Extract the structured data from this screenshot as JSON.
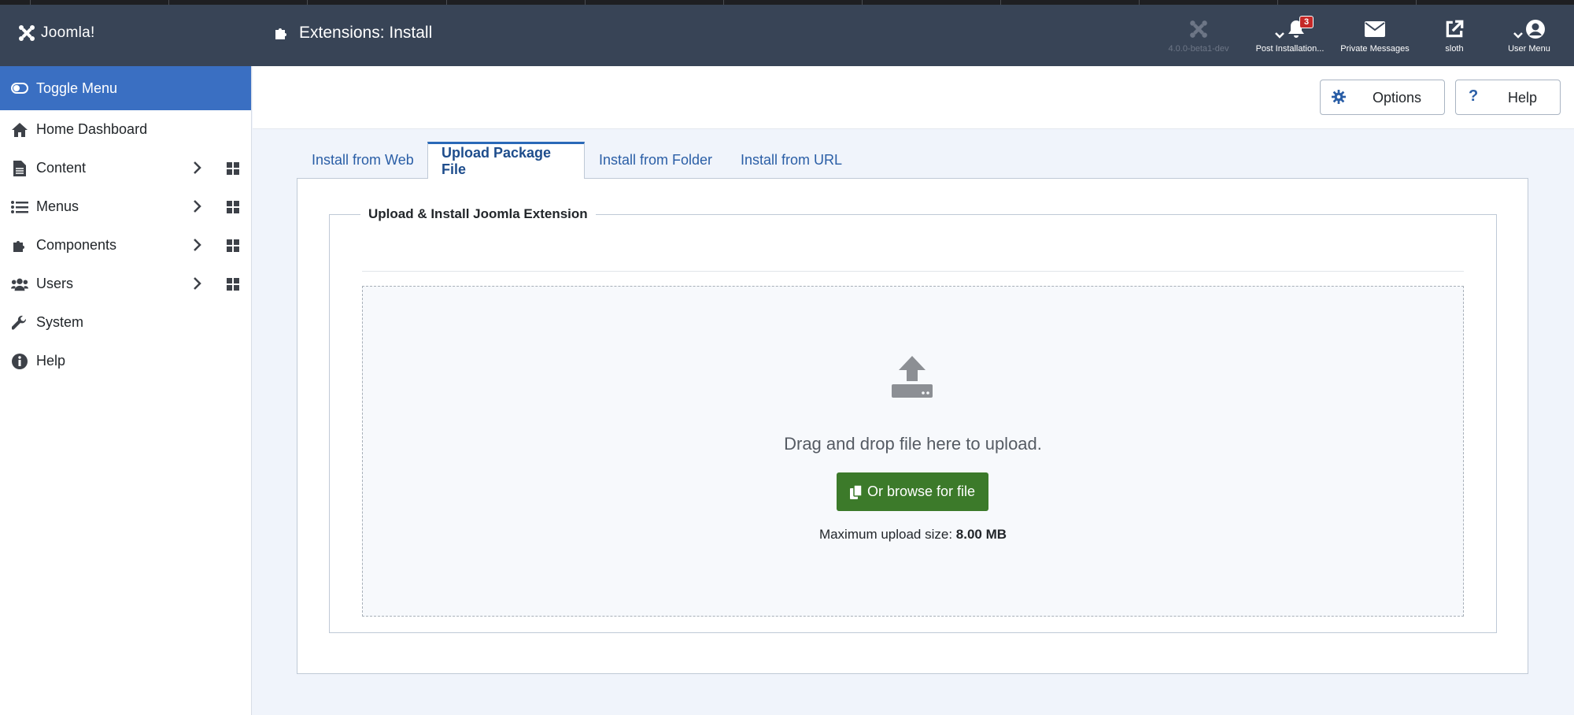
{
  "header": {
    "brand": "Joomla!",
    "page_title": "Extensions: Install",
    "version": "4.0.0-beta1-dev",
    "post_installation": "Post Installation...",
    "notification_count": "3",
    "private_messages": "Private Messages",
    "site_name": "sloth",
    "user_menu": "User Menu"
  },
  "sidebar": {
    "toggle_label": "Toggle Menu",
    "items": [
      {
        "label": "Home Dashboard"
      },
      {
        "label": "Content"
      },
      {
        "label": "Menus"
      },
      {
        "label": "Components"
      },
      {
        "label": "Users"
      },
      {
        "label": "System"
      },
      {
        "label": "Help"
      }
    ]
  },
  "toolbar": {
    "options_label": "Options",
    "help_label": "Help"
  },
  "tabs": [
    {
      "label": "Install from Web"
    },
    {
      "label": "Upload Package File"
    },
    {
      "label": "Install from Folder"
    },
    {
      "label": "Install from URL"
    }
  ],
  "upload": {
    "legend": "Upload & Install Joomla Extension",
    "drag_text": "Drag and drop file here to upload.",
    "browse_label": "Or browse for file",
    "max_label": "Maximum upload size:",
    "max_value": "8.00 MB"
  },
  "colors": {
    "header_bg": "#384456",
    "toggle_bg": "#3a6fc2",
    "browse_bg": "#3c7a2a",
    "badge_bg": "#c52827"
  }
}
